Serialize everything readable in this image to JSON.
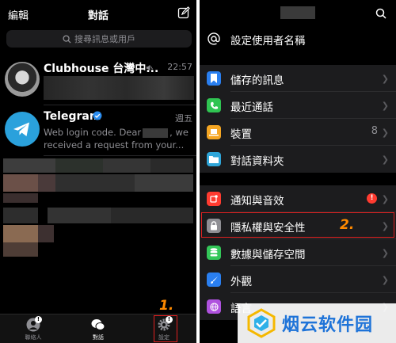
{
  "left": {
    "header": {
      "edit": "編輯",
      "title": "對話"
    },
    "search": {
      "placeholder": "搜尋訊息或用戶"
    },
    "chats": [
      {
        "name": "Clubhouse 台灣中...",
        "time": "22:57"
      },
      {
        "name": "Telegram",
        "time": "週五",
        "message_line1": "Web login code. Dear",
        "message_line1_end": ", we",
        "message_line2": "received a request from your..."
      }
    ],
    "tabs": [
      {
        "label": "聯絡人",
        "badge": "!"
      },
      {
        "label": "對話"
      },
      {
        "label": "設定",
        "badge": "!"
      }
    ],
    "step_label": "1."
  },
  "right": {
    "set_username": "設定使用者名稱",
    "items": [
      {
        "label": "儲存的訊息",
        "icon": "bookmark-icon",
        "color": "#2a7ff0"
      },
      {
        "label": "最近通話",
        "icon": "phone-icon",
        "color": "#30c452"
      },
      {
        "label": "裝置",
        "icon": "laptop-icon",
        "color": "#f5a623",
        "count": "8"
      },
      {
        "label": "對話資料夾",
        "icon": "folder-icon",
        "color": "#2fa5d8"
      },
      {
        "label": "通知與音效",
        "icon": "bell-icon",
        "color": "#ff3b30",
        "alert": "!"
      },
      {
        "label": "隱私權與安全性",
        "icon": "lock-icon",
        "color": "#8e8e93"
      },
      {
        "label": "數據與儲存空間",
        "icon": "database-icon",
        "color": "#34c759"
      },
      {
        "label": "外觀",
        "icon": "brush-icon",
        "color": "#2a7ff0"
      },
      {
        "label": "語言",
        "icon": "globe-icon",
        "color": "#af52de"
      }
    ],
    "step_label": "2."
  },
  "watermark": {
    "text": "烟云软件园"
  },
  "colors": {
    "accent_blue": "#2a7ff0",
    "highlight_red": "#e02020",
    "step_orange": "#ff8a00"
  }
}
